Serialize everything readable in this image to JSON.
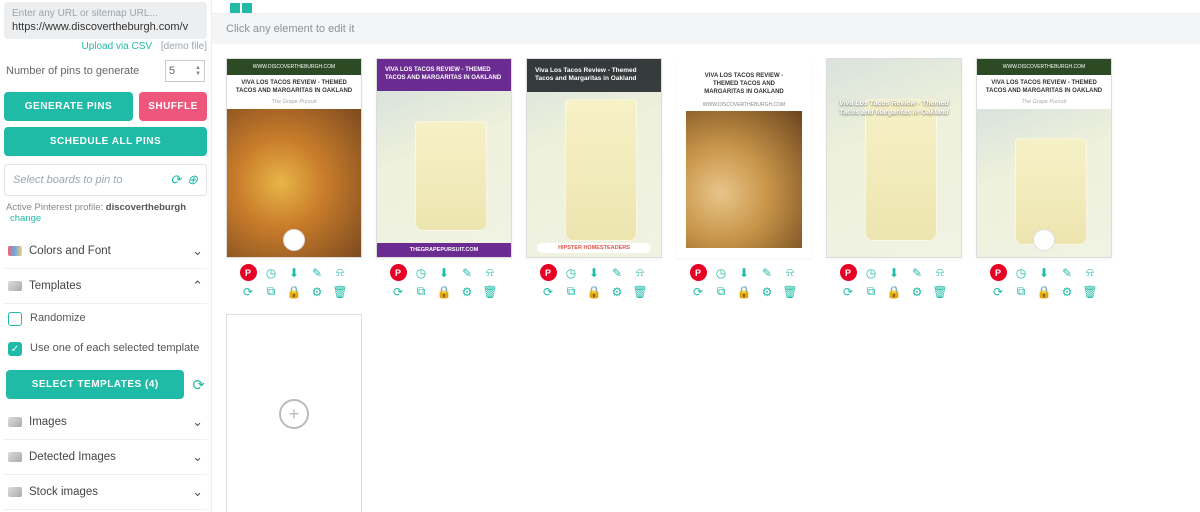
{
  "sidebar": {
    "url_hint": "Enter any URL or sitemap URL...",
    "url_value": "https://www.discovertheburgh.com/v",
    "upload_csv": "Upload via CSV",
    "demo_file": "[demo file]",
    "num_pins_label": "Number of pins to generate",
    "num_pins_value": "5",
    "generate_btn": "GENERATE PINS",
    "shuffle_btn": "SHUFFLE",
    "schedule_btn": "SCHEDULE ALL PINS",
    "boards_placeholder": "Select boards to pin to",
    "profile_label": "Active Pinterest profile:",
    "profile_name": "discovertheburgh",
    "profile_change": "change",
    "acc_colors": "Colors and Font",
    "acc_templates": "Templates",
    "chk_randomize": "Randomize",
    "chk_useone": "Use one of each selected template",
    "select_templates_btn": "SELECT TEMPLATES (4)",
    "acc_images": "Images",
    "acc_detected": "Detected Images",
    "acc_stock": "Stock images"
  },
  "main": {
    "hint": "Click any element to edit it"
  },
  "pins": [
    {
      "ribbon": "WWW.DISCOVERTHEBURGH.COM",
      "title": "VIVA LOS TACOS REVIEW - THEMED TACOS AND MARGARITAS IN OAKLAND",
      "sub": "The Grape Pursuit"
    },
    {
      "title": "VIVA LOS TACOS REVIEW - THEMED TACOS AND MARGARITAS IN OAKLAND",
      "footer": "THEGRAPEPURSUIT.COM"
    },
    {
      "title": "Viva Los Tacos Review - Themed Tacos and Margaritas in Oakland",
      "tag": "HIPSTER HOMESTEADERS"
    },
    {
      "title": "VIVA LOS TACOS REVIEW - THEMED TACOS AND MARGARITAS IN OAKLAND",
      "mini": "WWW.DISCOVERTHEBURGH.COM"
    },
    {
      "title": "Viva Los Tacos Review - Themed Tacos and Margaritas in Oakland"
    },
    {
      "ribbon": "WWW.DISCOVERTHEBURGH.COM",
      "title": "VIVA LOS TACOS REVIEW - THEMED TACOS AND MARGARITAS IN OAKLAND",
      "sub": "The Grape Pursuit"
    }
  ]
}
